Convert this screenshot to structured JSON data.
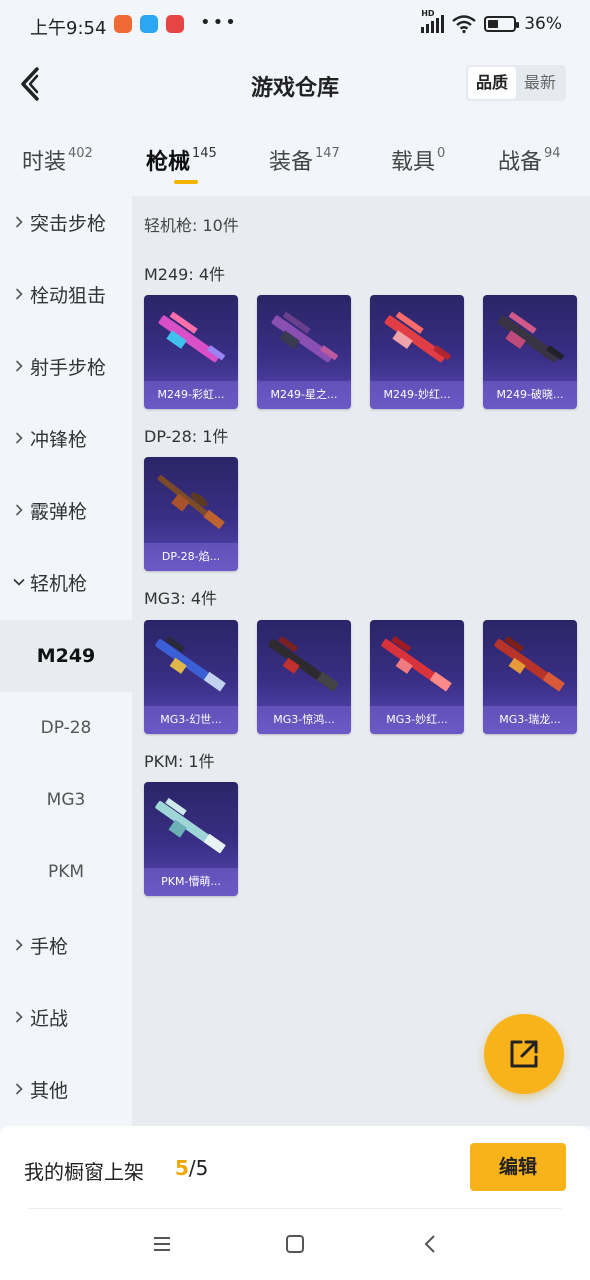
{
  "status_bar": {
    "time": "上午9:54",
    "dots": "•••",
    "network": "HD",
    "battery": "36%"
  },
  "header": {
    "title": "游戏仓库",
    "sort_options": [
      "品质",
      "最新"
    ],
    "sort_active": "品质"
  },
  "tabs": [
    {
      "label": "时装",
      "count": "402"
    },
    {
      "label": "枪械",
      "count": "145",
      "active": true
    },
    {
      "label": "装备",
      "count": "147"
    },
    {
      "label": "载具",
      "count": "0"
    },
    {
      "label": "战备",
      "count": "94"
    }
  ],
  "sidebar": {
    "items": [
      {
        "label": "突击步枪"
      },
      {
        "label": "栓动狙击"
      },
      {
        "label": "射手步枪"
      },
      {
        "label": "冲锋枪"
      },
      {
        "label": "霰弹枪"
      },
      {
        "label": "轻机枪"
      },
      {
        "label": "M249"
      },
      {
        "label": "DP-28"
      },
      {
        "label": "MG3"
      },
      {
        "label": "PKM"
      },
      {
        "label": "手枪"
      },
      {
        "label": "近战"
      },
      {
        "label": "其他"
      }
    ]
  },
  "content": {
    "summary": "轻机枪: 10件",
    "groups": [
      {
        "title": "M249: 4件",
        "items": [
          "M249-彩虹...",
          "M249-星之...",
          "M249-妙红...",
          "M249-破晓..."
        ]
      },
      {
        "title": "DP-28: 1件",
        "items": [
          "DP-28-焰..."
        ]
      },
      {
        "title": "MG3: 4件",
        "items": [
          "MG3-幻世...",
          "MG3-惊鸿...",
          "MG3-妙红...",
          "MG3-瑞龙..."
        ]
      },
      {
        "title": "PKM: 1件",
        "items": [
          "PKM-懵萌..."
        ]
      }
    ]
  },
  "bottom": {
    "label": "我的橱窗上架",
    "current": "5",
    "total": "/5",
    "edit_label": "编辑"
  },
  "colors": {
    "accent": "#f8b21a",
    "card_bg": "#3a2f86"
  }
}
